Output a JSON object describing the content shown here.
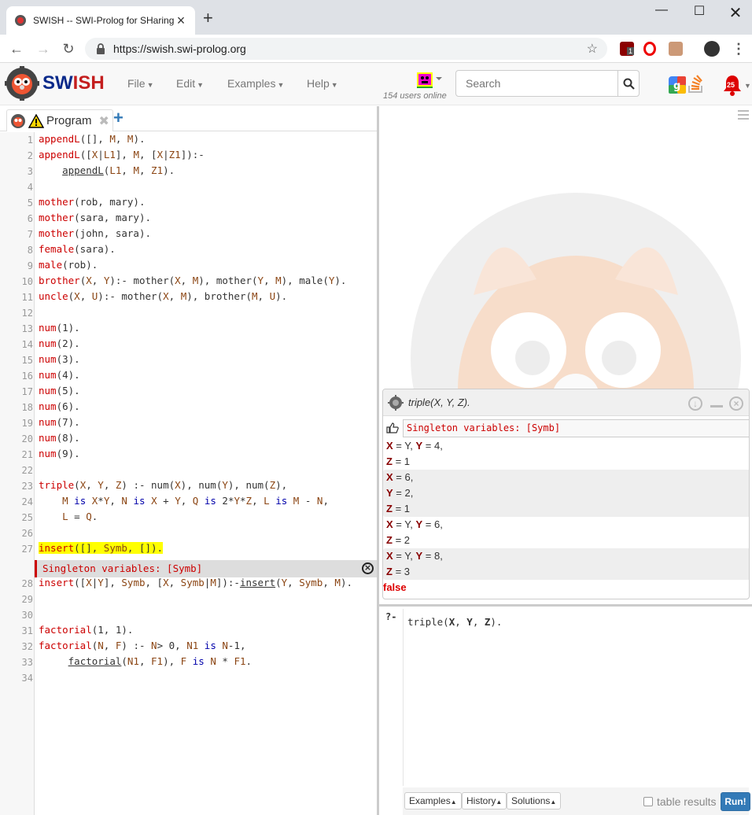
{
  "browser": {
    "tab_title": "SWISH -- SWI-Prolog for SHaring",
    "url": "https://swish.swi-prolog.org",
    "ext_badge": "1"
  },
  "navbar": {
    "brand": "SWISH",
    "menus": [
      {
        "label": "File"
      },
      {
        "label": "Edit"
      },
      {
        "label": "Examples"
      },
      {
        "label": "Help"
      }
    ],
    "users_online": "154 users online",
    "search_placeholder": "Search",
    "notification_count": "25"
  },
  "editor": {
    "tab_label": "Program",
    "add_tab": "+",
    "singleton_message": "Singleton variables: [Symb]",
    "lines": [
      {
        "n": "1",
        "t": "appendL([], M, M)."
      },
      {
        "n": "2",
        "t": "appendL([X|L1], M, [X|Z1]):-"
      },
      {
        "n": "3",
        "t": "    appendL(L1, M, Z1)."
      },
      {
        "n": "4",
        "t": ""
      },
      {
        "n": "5",
        "t": "mother(rob, mary)."
      },
      {
        "n": "6",
        "t": "mother(sara, mary)."
      },
      {
        "n": "7",
        "t": "mother(john, sara)."
      },
      {
        "n": "8",
        "t": "female(sara)."
      },
      {
        "n": "9",
        "t": "male(rob)."
      },
      {
        "n": "10",
        "t": "brother(X, Y):- mother(X, M), mother(Y, M), male(Y)."
      },
      {
        "n": "11",
        "t": "uncle(X, U):- mother(X, M), brother(M, U)."
      },
      {
        "n": "12",
        "t": ""
      },
      {
        "n": "13",
        "t": "num(1)."
      },
      {
        "n": "14",
        "t": "num(2)."
      },
      {
        "n": "15",
        "t": "num(3)."
      },
      {
        "n": "16",
        "t": "num(4)."
      },
      {
        "n": "17",
        "t": "num(5)."
      },
      {
        "n": "18",
        "t": "num(6)."
      },
      {
        "n": "19",
        "t": "num(7)."
      },
      {
        "n": "20",
        "t": "num(8)."
      },
      {
        "n": "21",
        "t": "num(9)."
      },
      {
        "n": "22",
        "t": ""
      },
      {
        "n": "23",
        "t": "triple(X, Y, Z) :- num(X), num(Y), num(Z),"
      },
      {
        "n": "24",
        "t": "    M is X*Y, N is X + Y, Q is 2*Y*Z, L is M - N,"
      },
      {
        "n": "25",
        "t": "    L = Q."
      },
      {
        "n": "26",
        "t": ""
      },
      {
        "n": "27",
        "t": "insert([], Symb, [])."
      },
      {
        "n": "28",
        "t": "insert([X|Y], Symb, [X, Symb|M]):-insert(Y, Symb, M)."
      },
      {
        "n": "29",
        "t": ""
      },
      {
        "n": "30",
        "t": ""
      },
      {
        "n": "31",
        "t": "factorial(1, 1)."
      },
      {
        "n": "32",
        "t": "factorial(N, F) :- N> 0, N1 is N-1,"
      },
      {
        "n": "33",
        "t": "     factorial(N1, F1), F is N * F1."
      },
      {
        "n": "34",
        "t": ""
      }
    ]
  },
  "runner": {
    "query": "triple(X, Y, Z).",
    "warning": "Singleton variables: [Symb]",
    "answers": [
      [
        "X = Y, Y = 4,",
        "Z = 1"
      ],
      [
        "X = 6,",
        "Y = 2,",
        "Z = 1"
      ],
      [
        "X = Y, Y = 6,",
        "Z = 2"
      ],
      [
        "X = Y, Y = 8,",
        "Z = 3"
      ]
    ],
    "result": "false"
  },
  "query_editor": {
    "prompt": "?-",
    "text": "triple(X, Y, Z).",
    "buttons": {
      "examples": "Examples",
      "history": "History",
      "solutions": "Solutions"
    },
    "table_results": "table results",
    "run": "Run!"
  }
}
